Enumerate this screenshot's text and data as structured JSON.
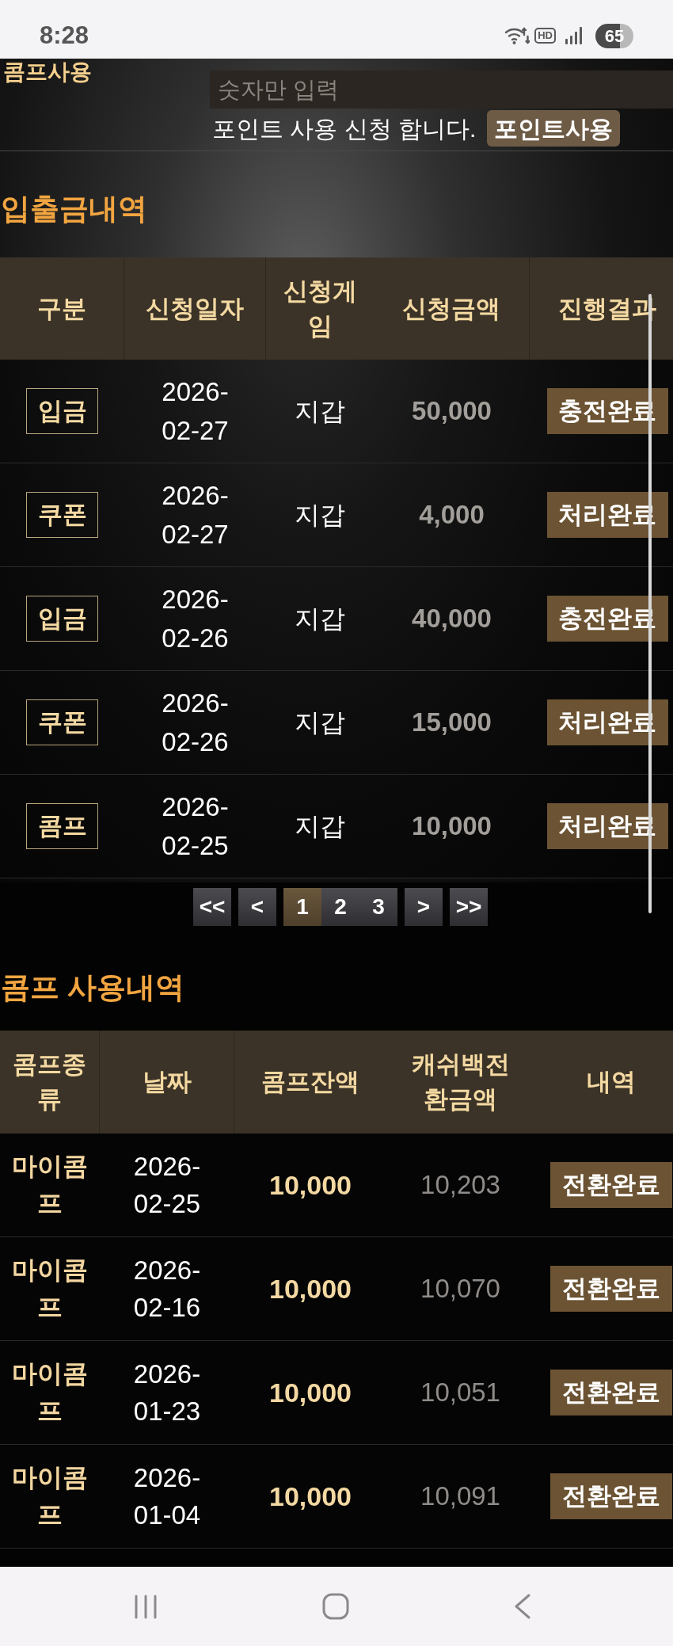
{
  "status_bar": {
    "time": "8:28",
    "hd": "HD",
    "battery": "65"
  },
  "comp_use": {
    "label": "콤프사용",
    "input": {
      "placeholder": "숫자만 입력"
    },
    "message": "포인트 사용 신청 합니다.",
    "button": "포인트사용"
  },
  "deposit_history": {
    "title": "입출금내역",
    "columns": [
      "구분",
      "신청일자",
      "신청게임",
      "신청금액",
      "진행결과"
    ],
    "rows": [
      {
        "type": "입금",
        "date": "2026-02-27",
        "game": "지갑",
        "amount": "50,000",
        "result": "충전완료"
      },
      {
        "type": "쿠폰",
        "date": "2026-02-27",
        "game": "지갑",
        "amount": "4,000",
        "result": "처리완료"
      },
      {
        "type": "입금",
        "date": "2026-02-26",
        "game": "지갑",
        "amount": "40,000",
        "result": "충전완료"
      },
      {
        "type": "쿠폰",
        "date": "2026-02-26",
        "game": "지갑",
        "amount": "15,000",
        "result": "처리완료"
      },
      {
        "type": "콤프",
        "date": "2026-02-25",
        "game": "지갑",
        "amount": "10,000",
        "result": "처리완료"
      }
    ]
  },
  "pagination": [
    {
      "kind": "first",
      "label": "<<",
      "selected": false
    },
    {
      "kind": "previous",
      "label": "<",
      "selected": false
    },
    {
      "kind": "page",
      "label": "1",
      "selected": true
    },
    {
      "kind": "page",
      "label": "2",
      "selected": false
    },
    {
      "kind": "page",
      "label": "3",
      "selected": false
    },
    {
      "kind": "next",
      "label": ">",
      "selected": false
    },
    {
      "kind": "last",
      "label": ">>",
      "selected": false
    }
  ],
  "comp_history": {
    "title": "콤프 사용내역",
    "columns": [
      "콤프종류",
      "날짜",
      "콤프잔액",
      "캐쉬백전환금액",
      "내역"
    ],
    "rows": [
      {
        "comp_type": "마이콤프",
        "date": "2026-02-25",
        "balance": "10,000",
        "cashback": "10,203",
        "detail": "전환완료"
      },
      {
        "comp_type": "마이콤프",
        "date": "2026-02-16",
        "balance": "10,000",
        "cashback": "10,070",
        "detail": "전환완료"
      },
      {
        "comp_type": "마이콤프",
        "date": "2026-01-23",
        "balance": "10,000",
        "cashback": "10,051",
        "detail": "전환완료"
      },
      {
        "comp_type": "마이콤프",
        "date": "2026-01-04",
        "balance": "10,000",
        "cashback": "10,091",
        "detail": "전환완료"
      }
    ]
  }
}
